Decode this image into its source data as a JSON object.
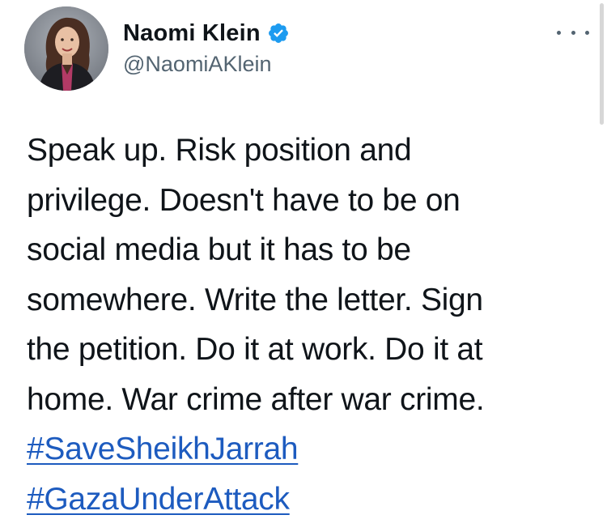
{
  "author": {
    "display_name": "Naomi Klein",
    "handle": "@NaomiAKlein",
    "verified": true,
    "verified_color": "#1d9bf0"
  },
  "tweet": {
    "text": "Speak up. Risk position and\nprivilege. Doesn't have to be on\nsocial media but it has to be\nsomewhere. Write the letter. Sign\nthe petition. Do it at work. Do it at\nhome. War crime after war crime.",
    "hashtags": [
      "#SaveSheikhJarrah",
      "#GazaUnderAttack"
    ],
    "hashtag_color": "#1d5bbf"
  },
  "menu": {
    "icon": "more-horizontal-icon"
  }
}
